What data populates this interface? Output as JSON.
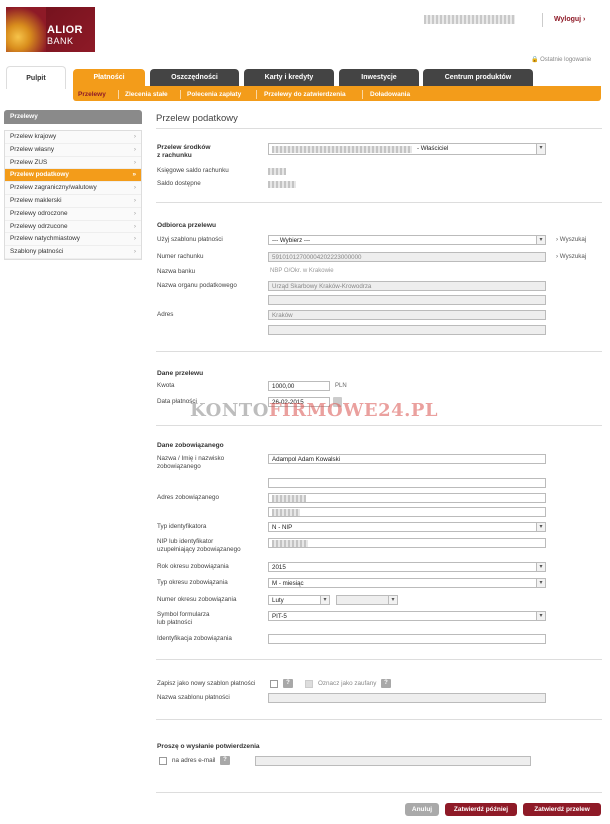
{
  "bank": {
    "name_line1": "ALIOR",
    "name_line2": "BANK"
  },
  "header": {
    "logout": "Wyloguj ›",
    "last_login": "🔒 Ostatnie logowanie"
  },
  "tabs": [
    {
      "label": "Pulpit"
    },
    {
      "label": "Płatności"
    },
    {
      "label": "Oszczędności"
    },
    {
      "label": "Karty i kredyty"
    },
    {
      "label": "Inwestycje"
    },
    {
      "label": "Centrum produktów"
    }
  ],
  "subnav": [
    "Przelewy",
    "Zlecenia stałe",
    "Polecenia zapłaty",
    "Przelewy do zatwierdzenia",
    "Doładowania"
  ],
  "sidebar": {
    "title": "Przelewy",
    "items": [
      "Przelew krajowy",
      "Przelew własny",
      "Przelew ZUS",
      "Przelew podatkowy",
      "Przelew zagraniczny/walutowy",
      "Przelew maklerski",
      "Przelewy odroczone",
      "Przelewy odrzucone",
      "Przelew natychmiastowy",
      "Szablony płatności"
    ]
  },
  "page": {
    "title": "Przelew podatkowy"
  },
  "source": {
    "label1": "Przelew środków",
    "label2": "z rachunku",
    "account_suffix": "- Właściciel",
    "book_balance": "Księgowe saldo rachunku",
    "available": "Saldo dostępne"
  },
  "recipient": {
    "section": "Odbiorca przelewu",
    "template_label": "Użyj szablonu płatności",
    "template_value": "--- Wybierz ---",
    "search": "› Wyszukaj",
    "account_label": "Numer rachunku",
    "account_value": "59101012700004202223000000",
    "bank_label": "Nazwa banku",
    "bank_value": "NBP O/Okr. w Krakowie",
    "office_label": "Nazwa organu podatkowego",
    "office_value": "Urząd Skarbowy Kraków-Krowodrza",
    "address_label": "Adres",
    "address_value": "Kraków"
  },
  "transfer": {
    "section": "Dane przelewu",
    "amount_label": "Kwota",
    "amount_value": "1000,00",
    "currency": "PLN",
    "date_label": "Data płatności",
    "date_value": "26-02-2015"
  },
  "obligor": {
    "section": "Dane zobowiązanego",
    "name_label1": "Nazwa / Imię i nazwisko",
    "name_label2": "zobowiązanego",
    "name_value": "Adampol Adam Kowalski",
    "addr_label": "Adres zobowiązanego",
    "idtype_label": "Typ identyfikatora",
    "idtype_value": "N - NIP",
    "nip_label1": "NIP lub identyfikator",
    "nip_label2": "uzupełniający zobowiązanego",
    "year_label": "Rok okresu zobowiązania",
    "year_value": "2015",
    "ptype_label": "Typ okresu zobowiązania",
    "ptype_value": "M - miesiąc",
    "pnum_label": "Numer okresu zobowiązania",
    "pnum_value": "Luty",
    "form_label1": "Symbol formularza",
    "form_label2": "lub płatności",
    "form_value": "PIT-5",
    "ident_label": "Identyfikacja zobowiązania"
  },
  "template": {
    "save_label": "Zapisz jako nowy szablon płatności",
    "trusted": "Oznacz jako zaufany",
    "name_label": "Nazwa szablonu płatności"
  },
  "confirm": {
    "section": "Proszę o wysłanie potwierdzenia",
    "email": "na adres e-mail"
  },
  "buttons": {
    "cancel": "Anuluj",
    "later": "Zatwierdź później",
    "confirm": "Zatwierdź przelew"
  },
  "watermark": {
    "part1": "KONTO",
    "part2": "FIRMOWE24.PL"
  },
  "colors": {
    "brand": "#8e1a27",
    "accent": "#f39c1a"
  }
}
